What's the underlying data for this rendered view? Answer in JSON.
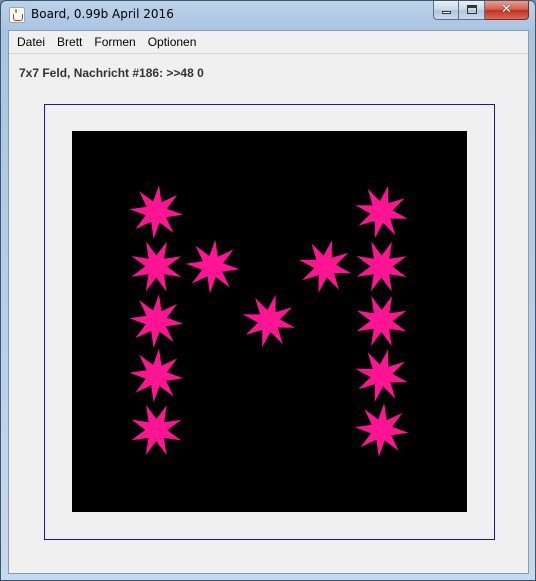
{
  "window": {
    "title": "Board, 0.99b April 2016"
  },
  "menu": {
    "items": [
      "Datei",
      "Brett",
      "Formen",
      "Optionen"
    ]
  },
  "status": {
    "text": "7x7 Feld, Nachricht #186: >>48 0"
  },
  "board": {
    "rows": 7,
    "cols": 7,
    "background": "#000000",
    "shape": "eight-point-star",
    "shape_color": "#ff1493",
    "cells": [
      {
        "row": 1,
        "col": 1
      },
      {
        "row": 1,
        "col": 5
      },
      {
        "row": 2,
        "col": 1
      },
      {
        "row": 2,
        "col": 2
      },
      {
        "row": 2,
        "col": 4
      },
      {
        "row": 2,
        "col": 5
      },
      {
        "row": 3,
        "col": 1
      },
      {
        "row": 3,
        "col": 3
      },
      {
        "row": 3,
        "col": 5
      },
      {
        "row": 4,
        "col": 1
      },
      {
        "row": 4,
        "col": 5
      },
      {
        "row": 5,
        "col": 1
      },
      {
        "row": 5,
        "col": 5
      }
    ]
  }
}
